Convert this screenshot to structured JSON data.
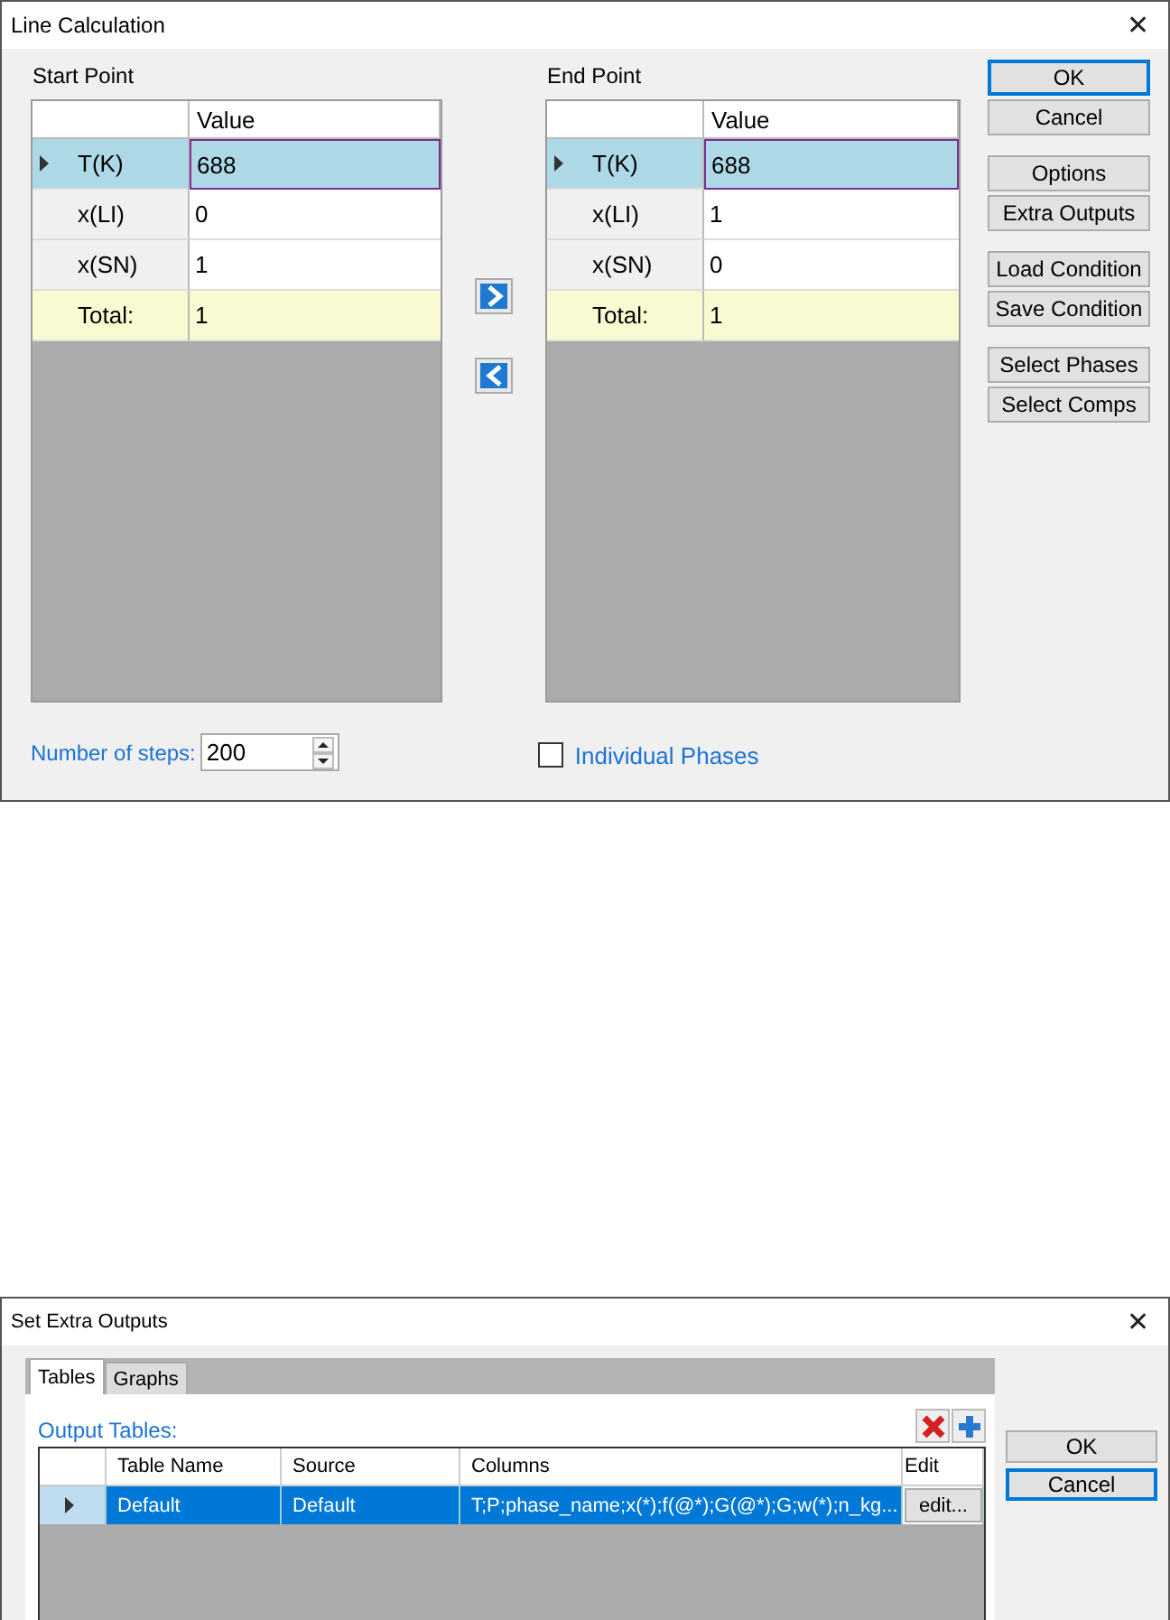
{
  "line_calc": {
    "title": "Line Calculation",
    "close": "✕",
    "start": {
      "title": "Start Point",
      "value_header": "Value",
      "rows": [
        {
          "label": "T(K)",
          "value": "688",
          "kind": "input",
          "selected": true
        },
        {
          "label": "x(LI)",
          "value": "0",
          "kind": "input",
          "selected": false
        },
        {
          "label": "x(SN)",
          "value": "1",
          "kind": "input",
          "selected": false
        },
        {
          "label": "Total:",
          "value": "1",
          "kind": "total",
          "selected": false
        }
      ]
    },
    "end": {
      "title": "End Point",
      "value_header": "Value",
      "rows": [
        {
          "label": "T(K)",
          "value": "688",
          "kind": "input",
          "selected": true
        },
        {
          "label": "x(LI)",
          "value": "1",
          "kind": "input",
          "selected": false
        },
        {
          "label": "x(SN)",
          "value": "0",
          "kind": "input",
          "selected": false
        },
        {
          "label": "Total:",
          "value": "1",
          "kind": "total",
          "selected": false
        }
      ]
    },
    "button_groups": [
      {
        "buttons": [
          {
            "label": "OK",
            "default": true
          },
          {
            "label": "Cancel",
            "default": false
          }
        ]
      },
      {
        "buttons": [
          {
            "label": "Options",
            "default": false
          },
          {
            "label": "Extra Outputs",
            "default": false
          }
        ]
      },
      {
        "buttons": [
          {
            "label": "Load Condition",
            "default": false
          },
          {
            "label": "Save Condition",
            "default": false
          }
        ]
      },
      {
        "buttons": [
          {
            "label": "Select Phases",
            "default": false
          },
          {
            "label": "Select Comps",
            "default": false
          }
        ]
      }
    ],
    "steps_label": "Number of steps:",
    "steps_value": "200",
    "individual_phases": {
      "label": "Individual Phases",
      "checked": false
    }
  },
  "extra_outputs": {
    "title": "Set Extra Outputs",
    "close": "✕",
    "tabs": [
      {
        "label": "Tables",
        "selected": true
      },
      {
        "label": "Graphs",
        "selected": false
      }
    ],
    "section_label": "Output Tables:",
    "columns": [
      "Table Name",
      "Source",
      "Columns",
      "Edit"
    ],
    "rows": [
      {
        "table_name": "Default",
        "source": "Default",
        "columns": "T;P;phase_name;x(*);f(@*);G(@*);G;w(*);n_kg...",
        "edit": "edit...",
        "selected": true
      }
    ],
    "buttons": [
      {
        "label": "OK",
        "default": false
      },
      {
        "label": "Cancel",
        "default": true
      }
    ]
  }
}
